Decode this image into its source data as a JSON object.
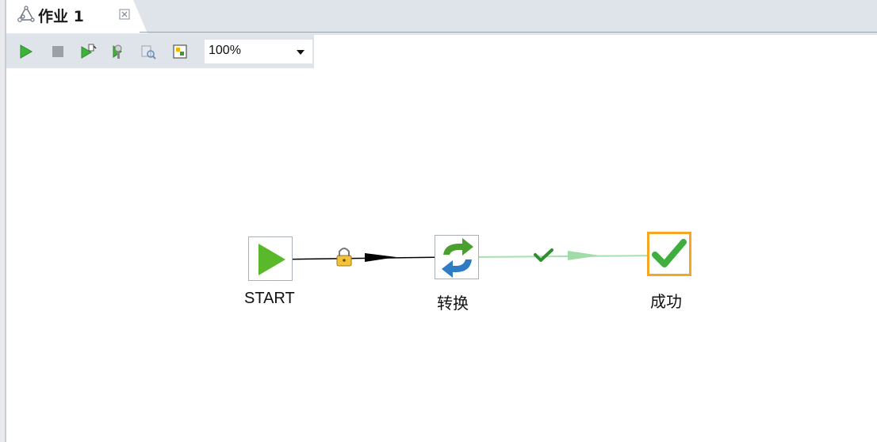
{
  "tab": {
    "title": "作业 1",
    "icon": "job-icon",
    "close_icon": "close-icon"
  },
  "toolbar": {
    "buttons": [
      "run-icon",
      "stop-icon",
      "preview-icon",
      "verify-icon",
      "sql-icon",
      "explorer-icon"
    ],
    "zoom": "100%"
  },
  "canvas": {
    "nodes": [
      {
        "label": "START",
        "icon": "start-play-icon"
      },
      {
        "label": "转换",
        "icon": "transformation-icon"
      },
      {
        "label": "成功",
        "icon": "success-check-icon",
        "selected": true
      }
    ],
    "hops": [
      {
        "from": "START",
        "to": "转换",
        "type": "unconditional",
        "icon": "lock-icon",
        "color": "#000000"
      },
      {
        "from": "转换",
        "to": "成功",
        "type": "on-success",
        "icon": "check-icon",
        "color": "#9fdca8"
      }
    ]
  },
  "colors": {
    "selection": "#f5a623",
    "success_green": "#3fae3f",
    "play_green": "#5ab82b"
  }
}
